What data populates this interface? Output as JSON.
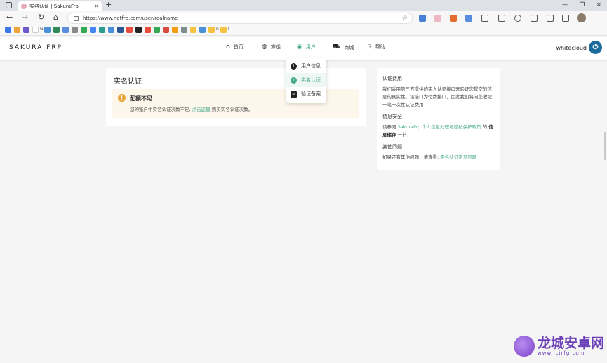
{
  "browser": {
    "tab_title": "实名认证 | SakuraFrp",
    "url": "https://www.natfrp.com/user/realname",
    "new_tab_symbol": "+",
    "tab_close": "×",
    "window_controls": {
      "minimize": "—",
      "maximize": "❐",
      "close": "✕"
    }
  },
  "bookmarks": [
    {
      "label": "",
      "color": "#3b78e7"
    },
    {
      "label": "",
      "color": "#f1a33b"
    },
    {
      "label": "",
      "color": "#6a5acd"
    },
    {
      "label": "G",
      "color": "#ffffff"
    },
    {
      "label": "",
      "color": "#4a90d9"
    },
    {
      "label": "",
      "color": "#2e8b57"
    },
    {
      "label": "",
      "color": "#5a8de0"
    },
    {
      "label": "",
      "color": "#888"
    },
    {
      "label": "",
      "color": "#34a853"
    },
    {
      "label": "",
      "color": "#4285f4"
    },
    {
      "label": "",
      "color": "#2a9d8f"
    },
    {
      "label": "",
      "color": "#4a90d9"
    },
    {
      "label": "",
      "color": "#2b5797"
    },
    {
      "label": "",
      "color": "#e84c3d"
    },
    {
      "label": "",
      "color": "#222"
    },
    {
      "label": "",
      "color": "#e84c3d"
    },
    {
      "label": "",
      "color": "#34a853"
    },
    {
      "label": "",
      "color": "#d94c3d"
    },
    {
      "label": "",
      "color": "#f39c12"
    },
    {
      "label": "",
      "color": "#7f8c8d"
    },
    {
      "label": "",
      "color": "#f5c242"
    },
    {
      "label": "",
      "color": "#4a90d9"
    },
    {
      "label": "n",
      "color": "#f5c242"
    },
    {
      "label": "I",
      "color": "#f5c242"
    }
  ],
  "site": {
    "brand": "SAKURA FRP",
    "nav": [
      {
        "icon": "⌂",
        "label": "首页",
        "active": false
      },
      {
        "icon": "◍",
        "label": "穿透",
        "active": false
      },
      {
        "icon": "◉",
        "label": "用户",
        "active": true
      },
      {
        "icon": "⛟",
        "label": "商城",
        "active": false
      },
      {
        "icon": "?",
        "label": "帮助",
        "active": false
      }
    ],
    "username": "whitecloud",
    "power_icon": "⏻"
  },
  "dropdown": {
    "items": [
      {
        "icon": "i",
        "label": "用户信息",
        "active": false
      },
      {
        "icon": "✓",
        "label": "实名认证",
        "active": true
      },
      {
        "icon": "≡",
        "label": "验证备案",
        "active": false
      }
    ]
  },
  "main": {
    "title": "实名认证",
    "alert": {
      "icon": "!",
      "title": "配额不足",
      "text_before": "您的账户中实名认证次数不足, ",
      "link": "点击这里",
      "text_after": " 购买实名认证次数。"
    }
  },
  "sidebar": {
    "sections": [
      {
        "heading": "认证费用",
        "text": "我们采用第三方提供的实人认证接口来验证您提交的信息的真实性。该接口为付费接口，因此我们将向您收取一笔一次性认证费用"
      },
      {
        "heading": "信息安全",
        "text_before": "请参阅 ",
        "link": "SakuraFrp 个人信息处理与隐私保护政策",
        "text_mid": " 的 ",
        "bold": "信息储存",
        "text_after": " 一节"
      },
      {
        "heading": "其他问题",
        "text_before": "如果还有其他问题，请查看: ",
        "link": "实名认证常见问题"
      }
    ]
  },
  "watermark": {
    "title": "龙城安卓网",
    "sub": "www.lcjrfg.com"
  },
  "colors": {
    "accent": "#45a88a",
    "warning": "#e7a33a",
    "power": "#1a6a9a"
  }
}
